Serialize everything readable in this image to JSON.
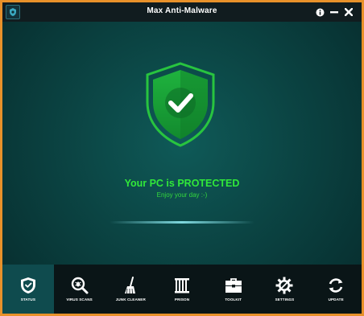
{
  "window": {
    "title": "Max Anti-Malware",
    "info_icon": "info-icon",
    "minimize_icon": "minimize-icon",
    "close_icon": "close-icon"
  },
  "status": {
    "title": "Your PC is PROTECTED",
    "subtitle": "Enjoy your day :-)",
    "icon": "shield-check-icon"
  },
  "nav": [
    {
      "label": "STATUS",
      "icon": "shield-icon",
      "active": true
    },
    {
      "label": "VIRUS SCANS",
      "icon": "magnifier-bug-icon",
      "active": false
    },
    {
      "label": "JUNK CLEANER",
      "icon": "broom-icon",
      "active": false
    },
    {
      "label": "PRISON",
      "icon": "prison-bars-icon",
      "active": false
    },
    {
      "label": "TOOLKIT",
      "icon": "toolbox-icon",
      "active": false
    },
    {
      "label": "SETTINGS",
      "icon": "gear-icon",
      "active": false
    },
    {
      "label": "UPDATE",
      "icon": "refresh-icon",
      "active": false
    }
  ],
  "colors": {
    "accent": "#31e83a",
    "frame": "#e8912a",
    "active_tab": "#0f4b4e"
  }
}
